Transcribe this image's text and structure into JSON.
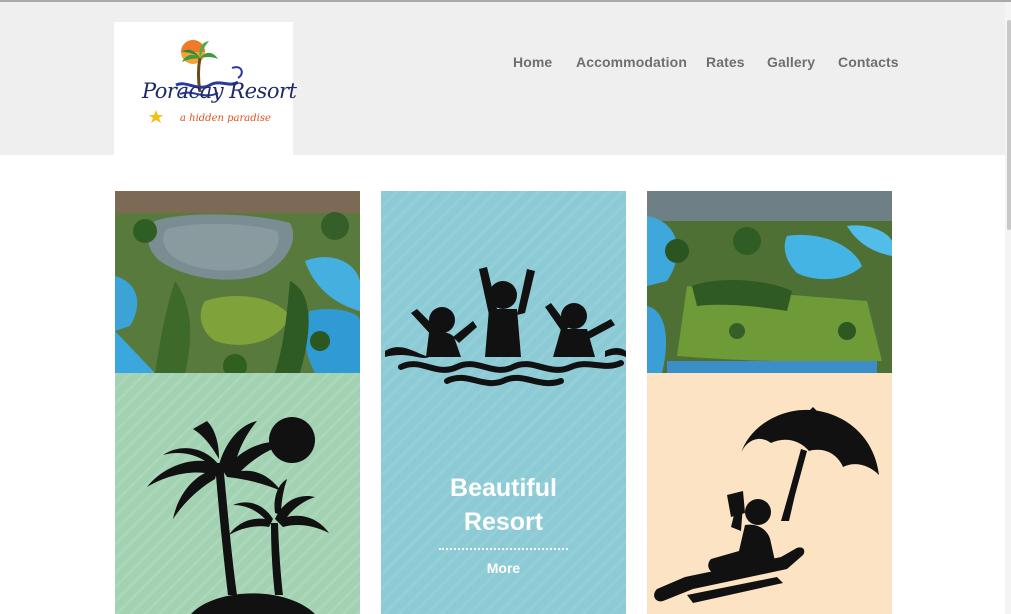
{
  "header": {
    "logo": {
      "brand": "Poracay Resort",
      "tagline": "a hidden paradise"
    },
    "nav": [
      {
        "label": "Home"
      },
      {
        "label": "Accommodation"
      },
      {
        "label": "Rates"
      },
      {
        "label": "Gallery"
      },
      {
        "label": "Contacts"
      }
    ]
  },
  "featured": {
    "title_line1": "Beautiful",
    "title_line2": "Resort",
    "more_label": "More"
  },
  "tiles": [
    {
      "kind": "photo",
      "subject": "aerial-lake-resort"
    },
    {
      "kind": "icon",
      "icon": "swimmers-icon",
      "color": "#8ccbd5"
    },
    {
      "kind": "photo",
      "subject": "aerial-pools-resort"
    },
    {
      "kind": "icon",
      "icon": "palm-island-icon",
      "color": "#a2d2b2"
    },
    {
      "kind": "icon",
      "icon": "beach-umbrella-icon",
      "color": "#fbe3c4"
    }
  ],
  "colors": {
    "header_bg": "#efefef",
    "nav_text": "#6f6f6f",
    "accent_blue": "#8ccbd5",
    "accent_green": "#a2d2b2",
    "accent_peach": "#fbe3c4"
  }
}
